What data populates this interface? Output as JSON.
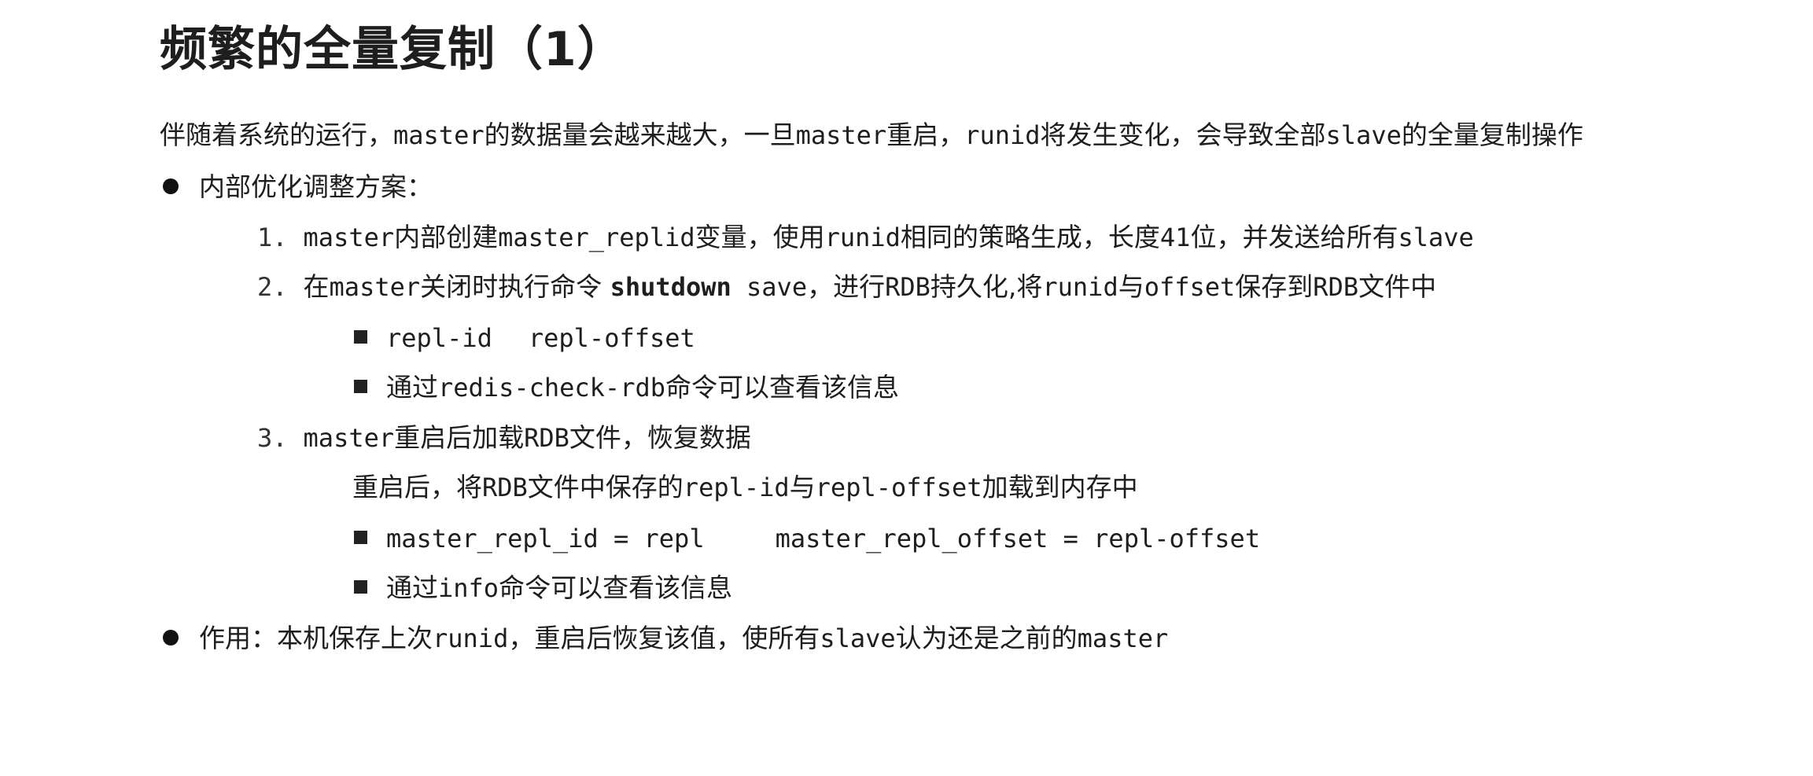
{
  "title": "频繁的全量复制（1）",
  "intro": {
    "t1": "伴随着系统的运行，",
    "c1": "master",
    "t2": "的数据量会越来越大，一旦",
    "c2": "master",
    "t3": "重启，",
    "c3": "runid",
    "t4": "将发生变化，会导致全部",
    "c4": "slave",
    "t5": "的全量复制操作"
  },
  "bullet1": {
    "label": "内部优化调整方案："
  },
  "step1": {
    "num": "1.",
    "c1": "master",
    "t1": "内部创建",
    "c2": "master_replid",
    "t2": "变量，使用",
    "c3": "runid",
    "t3": "相同的策略生成，长度",
    "c4": "41",
    "t4": "位，并发送给所有",
    "c5": "slave"
  },
  "step2": {
    "num": "2.",
    "t1": "在",
    "c1": "master",
    "t2": "关闭时执行命令 ",
    "cmd": "shutdown",
    "c2": " save",
    "t3": "，进行",
    "c3": "RDB",
    "t4": "持久化,将",
    "c4": "runid",
    "t5": "与",
    "c5": "offset",
    "t6": "保存到",
    "c6": "RDB",
    "t7": "文件中"
  },
  "sub2a": {
    "c1": "repl-id",
    "c2": "repl-offset"
  },
  "sub2b": {
    "t1": "通过",
    "c1": "redis-check-rdb",
    "t2": "命令可以查看该信息"
  },
  "step3": {
    "num": "3.",
    "c1": "master",
    "t1": "重启后加载",
    "c2": "RDB",
    "t2": "文件，恢复数据"
  },
  "step3note": {
    "t1": "重启后，将",
    "c1": "RDB",
    "t2": "文件中保存的",
    "c2": "repl-id",
    "t3": "与",
    "c3": "repl-offset",
    "t4": "加载到内存中"
  },
  "sub3a": {
    "c1": "master_repl_id = repl",
    "c2": "master_repl_offset = repl-offset"
  },
  "sub3b": {
    "t1": "通过",
    "c1": "info",
    "t2": "命令可以查看该信息"
  },
  "bullet2": {
    "t1": "作用：本机保存上次",
    "c1": "runid",
    "t2": "，重启后恢复该值，使所有",
    "c2": "slave",
    "t3": "认为还是之前的",
    "c3": "master"
  }
}
